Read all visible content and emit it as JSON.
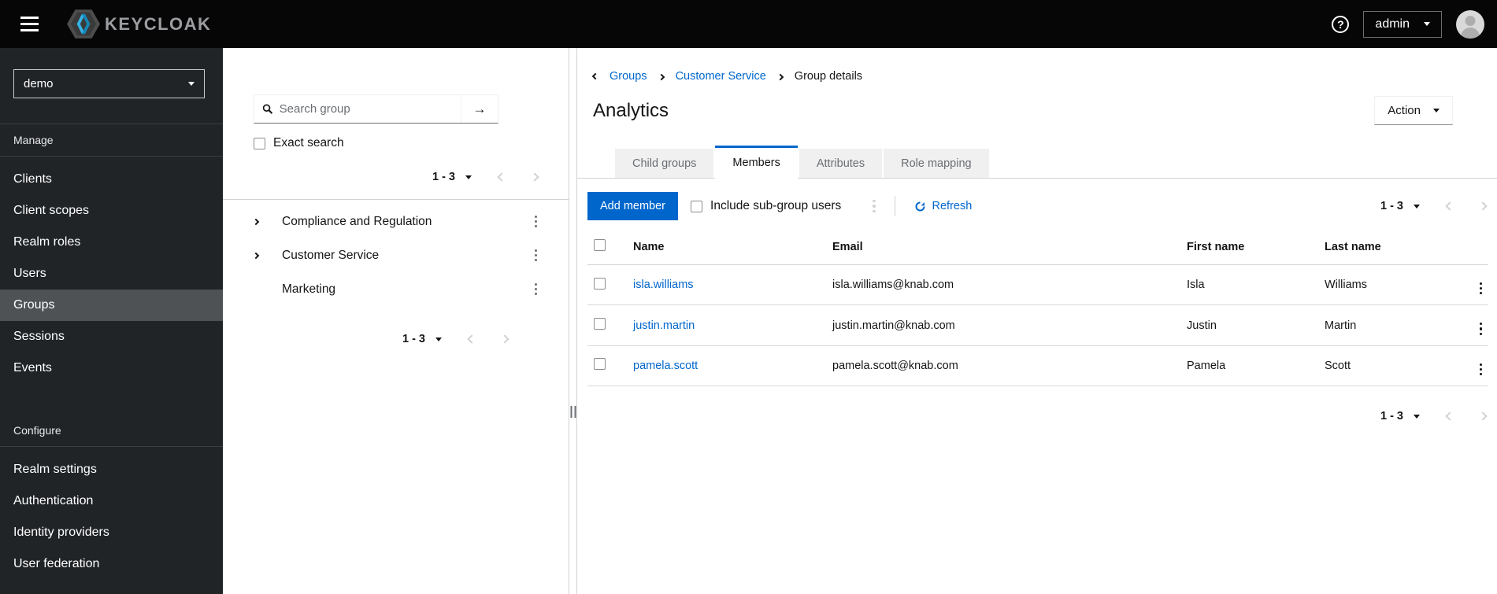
{
  "topbar": {
    "brand": "KEYCLOAK",
    "help_glyph": "?",
    "user": "admin"
  },
  "sidebar": {
    "realm": "demo",
    "manage": {
      "label": "Manage",
      "items": [
        "Clients",
        "Client scopes",
        "Realm roles",
        "Users",
        "Groups",
        "Sessions",
        "Events"
      ]
    },
    "configure": {
      "label": "Configure",
      "items": [
        "Realm settings",
        "Authentication",
        "Identity providers",
        "User federation"
      ]
    },
    "active_item": "Groups"
  },
  "groups_panel": {
    "search": {
      "placeholder": "Search group",
      "submit_glyph": "→"
    },
    "exact_search_label": "Exact search",
    "pagination_top": {
      "range": "1 - 3"
    },
    "tree": [
      {
        "label": "Compliance and Regulation",
        "expandable": true
      },
      {
        "label": "Customer Service",
        "expandable": true
      },
      {
        "label": "Marketing",
        "expandable": false
      }
    ],
    "pagination_bottom": {
      "range": "1 - 3"
    }
  },
  "main": {
    "breadcrumb": {
      "items": [
        "Groups",
        "Customer Service",
        "Group details"
      ]
    },
    "title": "Analytics",
    "action_label": "Action",
    "tabs": [
      "Child groups",
      "Members",
      "Attributes",
      "Role mapping"
    ],
    "active_tab": "Members",
    "toolbar": {
      "add_member": "Add member",
      "include_subgroups": "Include sub-group users",
      "refresh": "Refresh",
      "pagination": {
        "range": "1 - 3"
      }
    },
    "table": {
      "headers": [
        "Name",
        "Email",
        "First name",
        "Last name"
      ],
      "rows": [
        {
          "name": "isla.williams",
          "email": "isla.williams@knab.com",
          "first_name": "Isla",
          "last_name": "Williams"
        },
        {
          "name": "justin.martin",
          "email": "justin.martin@knab.com",
          "first_name": "Justin",
          "last_name": "Martin"
        },
        {
          "name": "pamela.scott",
          "email": "pamela.scott@knab.com",
          "first_name": "Pamela",
          "last_name": "Scott"
        }
      ]
    },
    "pagination_bottom": {
      "range": "1 - 3"
    }
  },
  "colors": {
    "accent": "#0066cc",
    "link": "#0066cc",
    "topbar_bg": "#060606",
    "sidebar_bg": "#212427",
    "sidebar_active_bg": "#4f5255",
    "tab_inactive_bg": "#f0f0f0",
    "border": "#d2d2d2",
    "text": "#151515",
    "muted_text": "#6a6e73"
  }
}
